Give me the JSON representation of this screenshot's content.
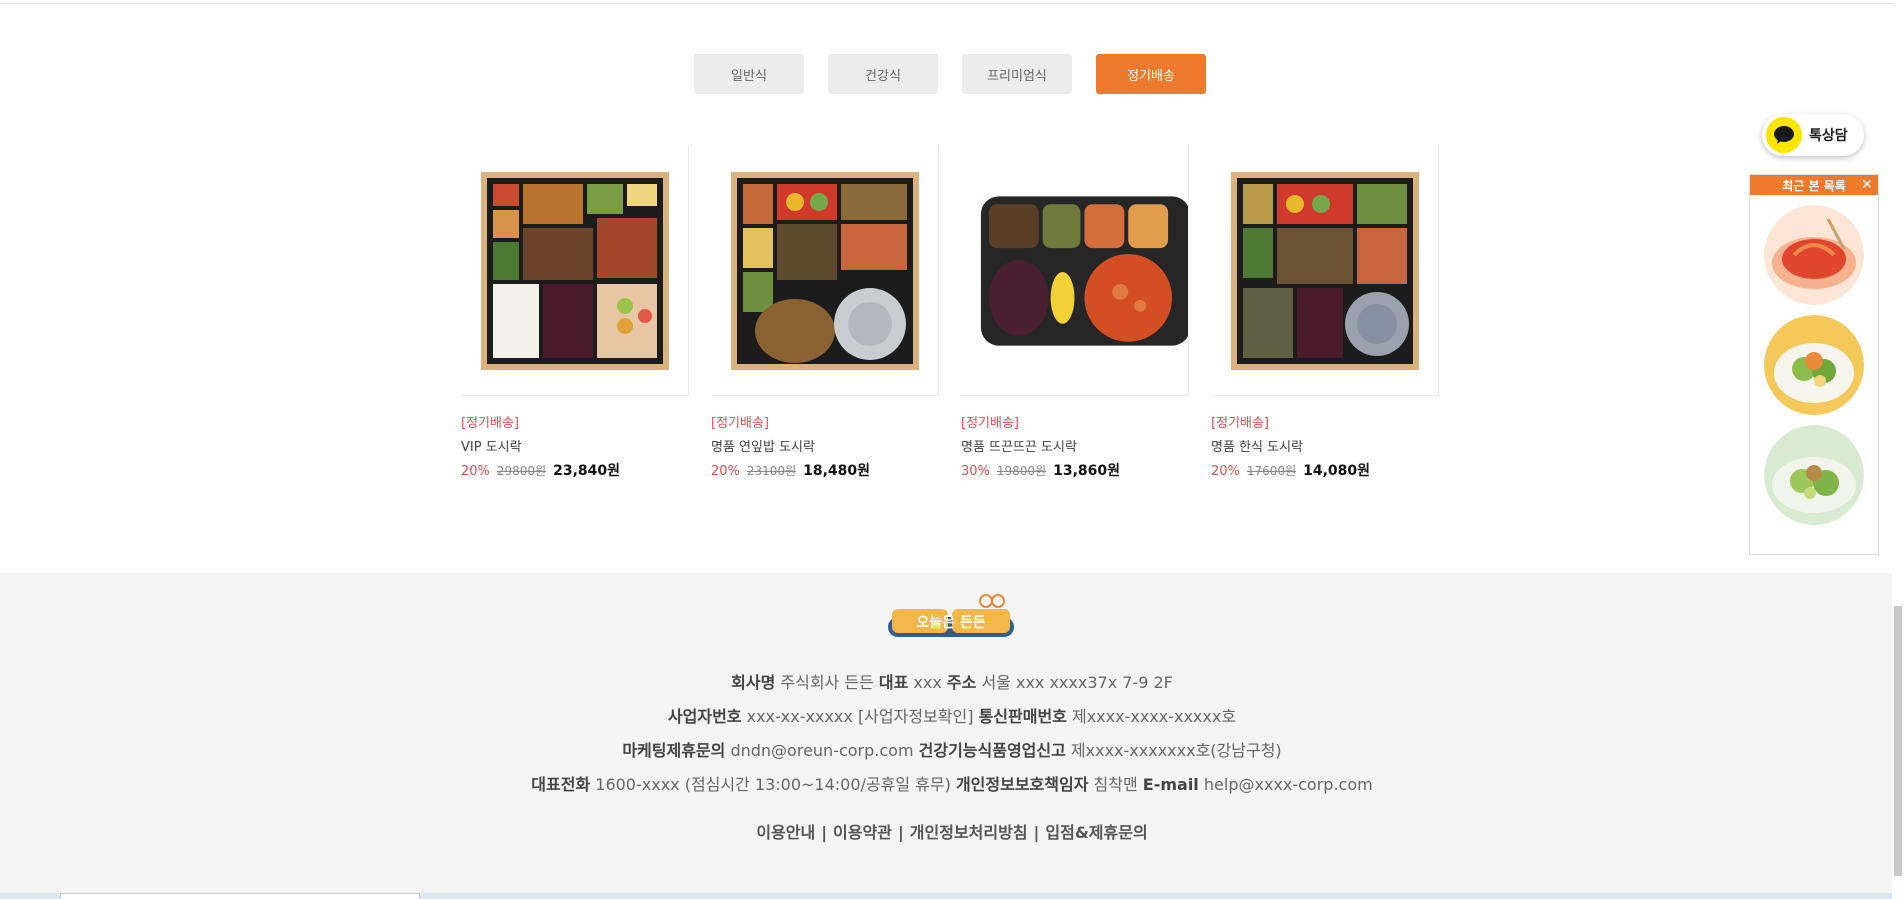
{
  "tabs": [
    {
      "label": "일반식"
    },
    {
      "label": "건강식"
    },
    {
      "label": "프리미엄식"
    },
    {
      "label": "정기배송"
    }
  ],
  "products": [
    {
      "tag": "[정기배송]",
      "name": "VIP 도시락",
      "rate": "20%",
      "orig": "29800원",
      "sale": "23,840원"
    },
    {
      "tag": "[정기배송]",
      "name": "명품 연잎밥 도시락",
      "rate": "20%",
      "orig": "23100원",
      "sale": "18,480원"
    },
    {
      "tag": "[정기배송]",
      "name": "명품 뜨끈뜨끈 도시락",
      "rate": "30%",
      "orig": "19800원",
      "sale": "13,860원"
    },
    {
      "tag": "[정기배송]",
      "name": "명품 한식 도시락",
      "rate": "20%",
      "orig": "17600원",
      "sale": "14,080원"
    }
  ],
  "footer": {
    "logo_text": "오늘은 든든",
    "line1": {
      "k1": "회사명",
      "v1": " 주식회사 든든 ",
      "k2": "대표",
      "v2": " xxx ",
      "k3": "주소",
      "v3": " 서울 xxx xxxx37x 7-9 2F"
    },
    "line2": {
      "k1": "사업자번호",
      "v1": " xxx-xx-xxxxx [사업자정보확인] ",
      "k2": "통신판매번호",
      "v2": " 제xxxx-xxxx-xxxxx호"
    },
    "line3": {
      "k1": "마케팅제휴문의",
      "v1": " dndn@oreun-corp.com ",
      "k2": "건강기능식품영업신고",
      "v2": " 제xxxx-xxxxxxx호(강남구청)"
    },
    "line4": {
      "k1": "대표전화",
      "v1": " 1600-xxxx (점심시간 13:00~14:00/공휴일 휴무) ",
      "k2": "개인정보보호책임자",
      "v2": " 침착맨 ",
      "k3": "E-mail",
      "v3": " help@xxxx-corp.com"
    },
    "links": [
      "이용안내",
      "이용약관",
      "개인정보처리방침",
      "입점&제휴문의"
    ],
    "sep": "|"
  },
  "kakao": {
    "label": "톡상담",
    "icon": "chat-bubble-icon"
  },
  "recent": {
    "title": "최근 본 목록",
    "close": "✕"
  },
  "colors": {
    "accent": "#ee7a2d",
    "sale_red": "#e05050",
    "kakao_yellow": "#fee500"
  }
}
